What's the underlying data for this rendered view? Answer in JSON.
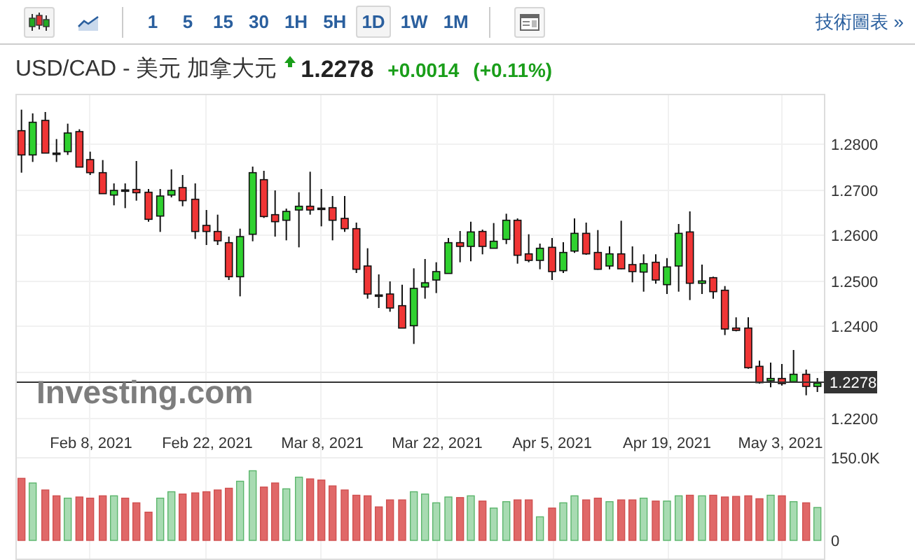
{
  "toolbar": {
    "chart_types": [
      {
        "kind": "candlestick",
        "selected": true
      },
      {
        "kind": "line",
        "selected": false
      }
    ],
    "intervals": [
      {
        "label": "1",
        "selected": false
      },
      {
        "label": "5",
        "selected": false
      },
      {
        "label": "15",
        "selected": false
      },
      {
        "label": "30",
        "selected": false
      },
      {
        "label": "1H",
        "selected": false
      },
      {
        "label": "5H",
        "selected": false
      },
      {
        "label": "1D",
        "selected": true
      },
      {
        "label": "1W",
        "selected": false
      },
      {
        "label": "1M",
        "selected": false
      }
    ],
    "link": "技術圖表 »"
  },
  "quote": {
    "symbol": "USD/CAD - 美元 加拿大元",
    "rising": true,
    "price": "1.2278",
    "change": "+0.0014",
    "change_percent": "(+0.11%)"
  },
  "chart": {
    "price_labels": [
      "1.2800",
      "1.2700",
      "1.2600",
      "1.2500",
      "1.2400",
      "1.2200"
    ],
    "current_price": "1.2278",
    "date_labels": [
      "Feb 8, 2021",
      "Feb 22, 2021",
      "Mar 8, 2021",
      "Mar 22, 2021",
      "Apr 5, 2021",
      "Apr 19, 2021",
      "May 3, 2021"
    ],
    "volume_labels": [
      "150.0K",
      "0"
    ],
    "logo": "Investing.com"
  }
}
